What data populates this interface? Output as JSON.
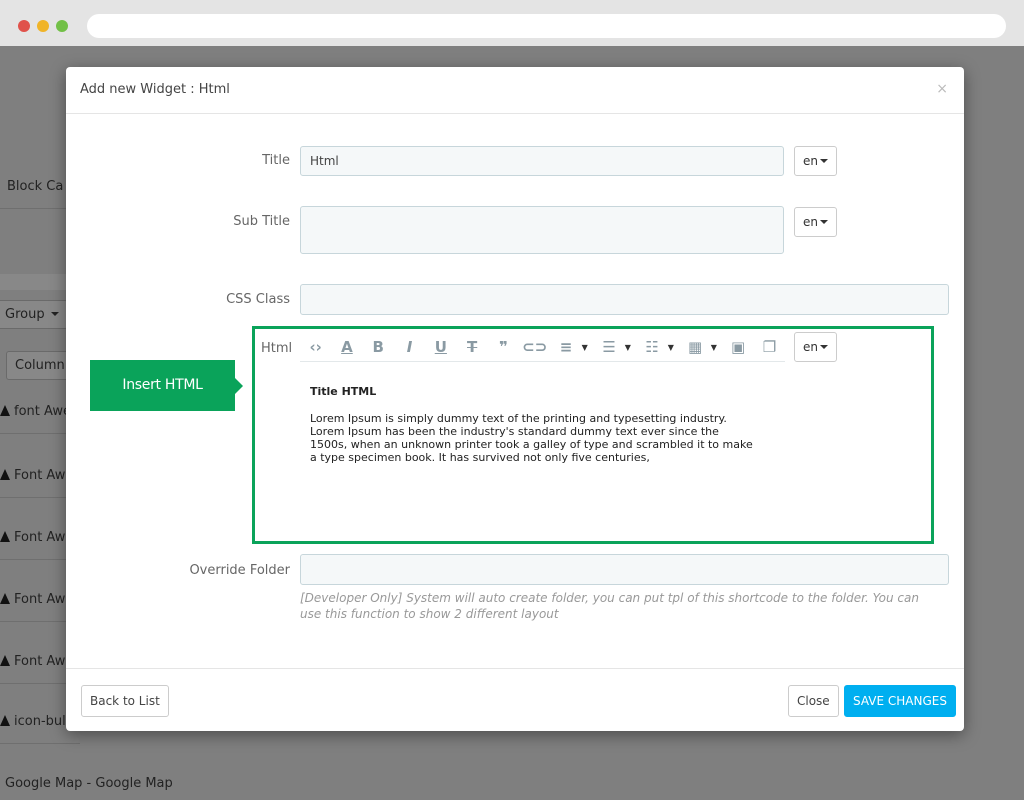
{
  "background": {
    "rows": [
      "Block Ca",
      "font Awe",
      "Font Aw",
      "Font Aw",
      "Font Aw",
      "Font Aw",
      "icon-bul",
      "Google Map - Google Map"
    ],
    "group_button": "Group",
    "column_button": "Column"
  },
  "modal": {
    "title": "Add new Widget : Html",
    "close_symbol": "×",
    "fields": {
      "title_label": "Title",
      "title_value": "Html",
      "subtitle_label": "Sub Title",
      "subtitle_value": "",
      "css_label": "CSS Class",
      "css_value": "",
      "html_label": "Html",
      "override_label": "Override Folder",
      "override_value": "",
      "override_help": "[Developer Only] System will auto create folder, you can put tpl of this shortcode to the folder. You can use this function to show 2 different layout"
    },
    "lang": "en",
    "editor": {
      "heading": "Title HTML",
      "body_lines": [
        "Lorem Ipsum is simply dummy text of the printing and typesetting industry.",
        "Lorem Ipsum has been the industry's standard dummy text ever since the",
        "1500s, when an unknown printer took a galley of type and scrambled it to make",
        "a type specimen book. It has survived not only five centuries,"
      ]
    },
    "callout": "Insert HTML",
    "footer": {
      "back": "Back to List",
      "close": "Close",
      "save": "SAVE CHANGES"
    }
  },
  "colors": {
    "accent_green": "#0aa35a",
    "save_blue": "#00aff0"
  }
}
